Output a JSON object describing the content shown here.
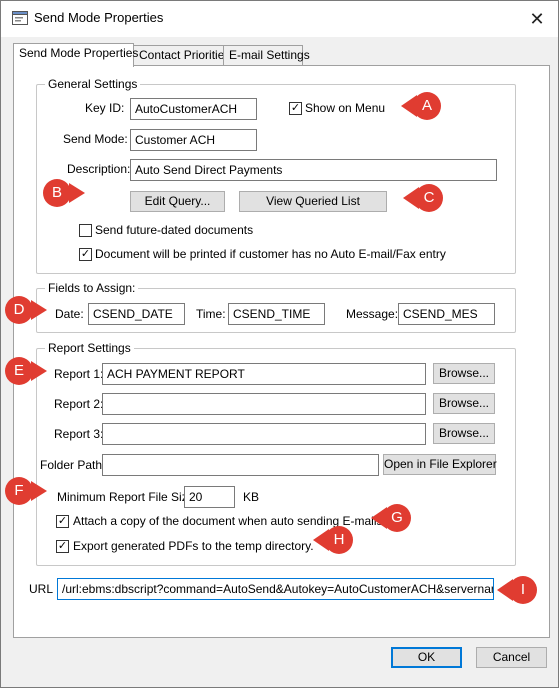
{
  "window": {
    "title": "Send Mode Properties",
    "close_glyph": "✕"
  },
  "tabs": [
    {
      "label": "Send Mode Properties",
      "active": true
    },
    {
      "label": "Contact Priorities",
      "active": false
    },
    {
      "label": "E-mail Settings",
      "active": false
    }
  ],
  "general": {
    "legend": "General Settings",
    "key_id_label": "Key ID:",
    "key_id_value": "AutoCustomerACH",
    "show_on_menu_label": "Show on Menu",
    "show_on_menu_checked": true,
    "send_mode_label": "Send Mode:",
    "send_mode_value": "Customer ACH",
    "description_label": "Description:",
    "description_value": "Auto Send Direct Payments",
    "edit_query_label": "Edit Query...",
    "view_queried_list_label": "View Queried List",
    "send_future_label": "Send future-dated documents",
    "send_future_checked": false,
    "print_if_none_label": "Document will be printed if customer has no Auto E-mail/Fax entry",
    "print_if_none_checked": true
  },
  "fields": {
    "legend": "Fields to Assign:",
    "date_label": "Date:",
    "date_value": "CSEND_DATE",
    "time_label": "Time:",
    "time_value": "CSEND_TIME",
    "message_label": "Message:",
    "message_value": "CSEND_MES"
  },
  "report": {
    "legend": "Report Settings",
    "reports": [
      {
        "label": "Report 1:",
        "value": "ACH PAYMENT REPORT",
        "browse": "Browse..."
      },
      {
        "label": "Report 2:",
        "value": "",
        "browse": "Browse..."
      },
      {
        "label": "Report 3:",
        "value": "",
        "browse": "Browse..."
      }
    ],
    "folder_path_label": "Folder Path:",
    "folder_path_value": "",
    "open_explorer_label": "Open in File Explorer",
    "min_size_label": "Minimum Report File Size:",
    "min_size_value": "20",
    "min_size_unit": "KB",
    "attach_copy_label": "Attach a copy of the document when auto sending E-mails.",
    "attach_copy_checked": true,
    "export_pdfs_label": "Export generated PDFs to the temp directory.",
    "export_pdfs_checked": true
  },
  "url": {
    "label": "URL",
    "value": "/url:ebms:dbscript?command=AutoSend&Autokey=AutoCustomerACH&servername=ebms&c"
  },
  "buttons": {
    "ok": "OK",
    "cancel": "Cancel"
  },
  "callouts": [
    "A",
    "B",
    "C",
    "D",
    "E",
    "F",
    "G",
    "H",
    "I"
  ],
  "colors": {
    "callout": "#e03c31",
    "focus": "#0078d7",
    "panel": "#ffffff",
    "chrome": "#f0f0f0"
  },
  "icons": {
    "window_icon": "form-window-icon",
    "close": "close-icon",
    "check": "✓"
  }
}
